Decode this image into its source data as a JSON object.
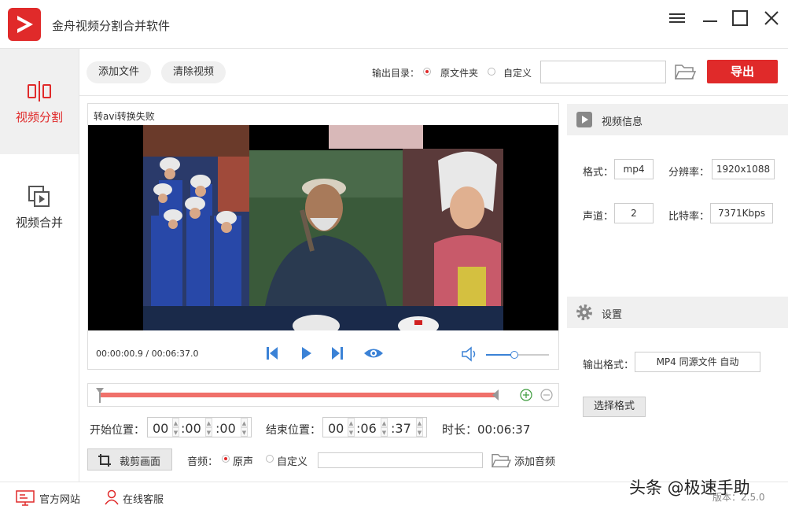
{
  "app": {
    "title": "金舟视频分割合并软件"
  },
  "sidebar": {
    "items": [
      {
        "label": "视频分割",
        "icon": "split-icon",
        "active": true
      },
      {
        "label": "视频合并",
        "icon": "merge-icon",
        "active": false
      }
    ]
  },
  "toolbar": {
    "add_file": "添加文件",
    "clear_video": "清除视频",
    "output_dir_label": "输出目录：",
    "option_source": "原文件夹",
    "option_custom": "自定义",
    "path_value": "",
    "export": "导出"
  },
  "player": {
    "status": "转avi转换失败",
    "time_display": "00:00:00.9 / 00:06:37.0",
    "volume_level": 0.45
  },
  "trim": {
    "start_label": "开始位置：",
    "start": {
      "h": "00",
      "m": ":00",
      "s": ":00"
    },
    "end_label": "结束位置：",
    "end": {
      "h": "00",
      "m": ":06",
      "s": ":37"
    },
    "duration_label": "时长：",
    "duration": "00:06:37"
  },
  "bottom_controls": {
    "crop": "裁剪画面",
    "audio_label": "音频：",
    "audio_original": "原声",
    "audio_custom": "自定义",
    "add_audio": "添加音频"
  },
  "video_info": {
    "header": "视频信息",
    "format_label": "格式：",
    "format": "mp4",
    "resolution_label": "分辨率：",
    "resolution": "1920x1088",
    "channels_label": "声道：",
    "channels": "2",
    "bitrate_label": "比特率：",
    "bitrate": "7371Kbps"
  },
  "settings": {
    "header": "设置",
    "output_format_label": "输出格式：",
    "output_format": "MP4 同源文件 自动",
    "choose_format": "选择格式"
  },
  "footer": {
    "website": "官方网站",
    "support": "在线客服",
    "watermark": "头条 @极速手助",
    "version": "版本：2.5.0"
  },
  "colors": {
    "accent": "#e02a2a",
    "blue": "#3b82d6",
    "timeline": "#f0706a"
  }
}
